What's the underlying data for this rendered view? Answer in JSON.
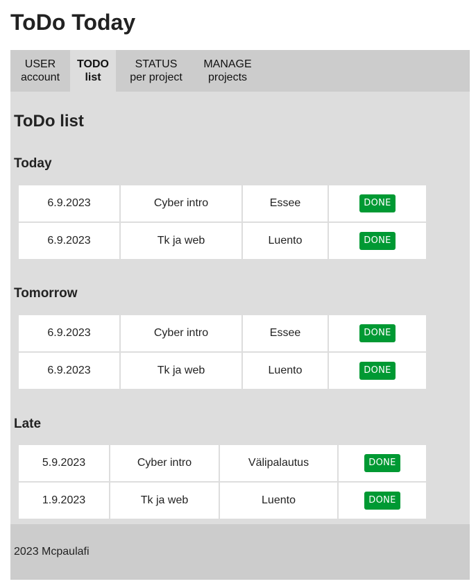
{
  "app": {
    "title": "ToDo Today"
  },
  "nav": [
    {
      "line1": "USER",
      "line2": "account"
    },
    {
      "line1": "TODO",
      "line2": "list"
    },
    {
      "line1": "STATUS",
      "line2": "per project"
    },
    {
      "line1": "MANAGE",
      "line2": "projects"
    }
  ],
  "main": {
    "title": "ToDo list",
    "sections": [
      {
        "heading": "Today",
        "rows": [
          {
            "date": "6.9.2023",
            "project": "Cyber intro",
            "task": "Essee",
            "action": "DONE"
          },
          {
            "date": "6.9.2023",
            "project": "Tk ja web",
            "task": "Luento",
            "action": "DONE"
          }
        ]
      },
      {
        "heading": "Tomorrow",
        "rows": [
          {
            "date": "6.9.2023",
            "project": "Cyber intro",
            "task": "Essee",
            "action": "DONE"
          },
          {
            "date": "6.9.2023",
            "project": "Tk ja web",
            "task": "Luento",
            "action": "DONE"
          }
        ]
      },
      {
        "heading": "Late",
        "rows": [
          {
            "date": "5.9.2023",
            "project": "Cyber intro",
            "task": "Välipalautus",
            "action": "DONE"
          },
          {
            "date": "1.9.2023",
            "project": "Tk ja web",
            "task": "Luento",
            "action": "DONE"
          }
        ]
      }
    ]
  },
  "footer": {
    "text": "2023 Mcpaulafi"
  },
  "colors": {
    "nav_bg": "#cccccc",
    "main_bg": "#dddddd",
    "done_button": "#009933"
  }
}
